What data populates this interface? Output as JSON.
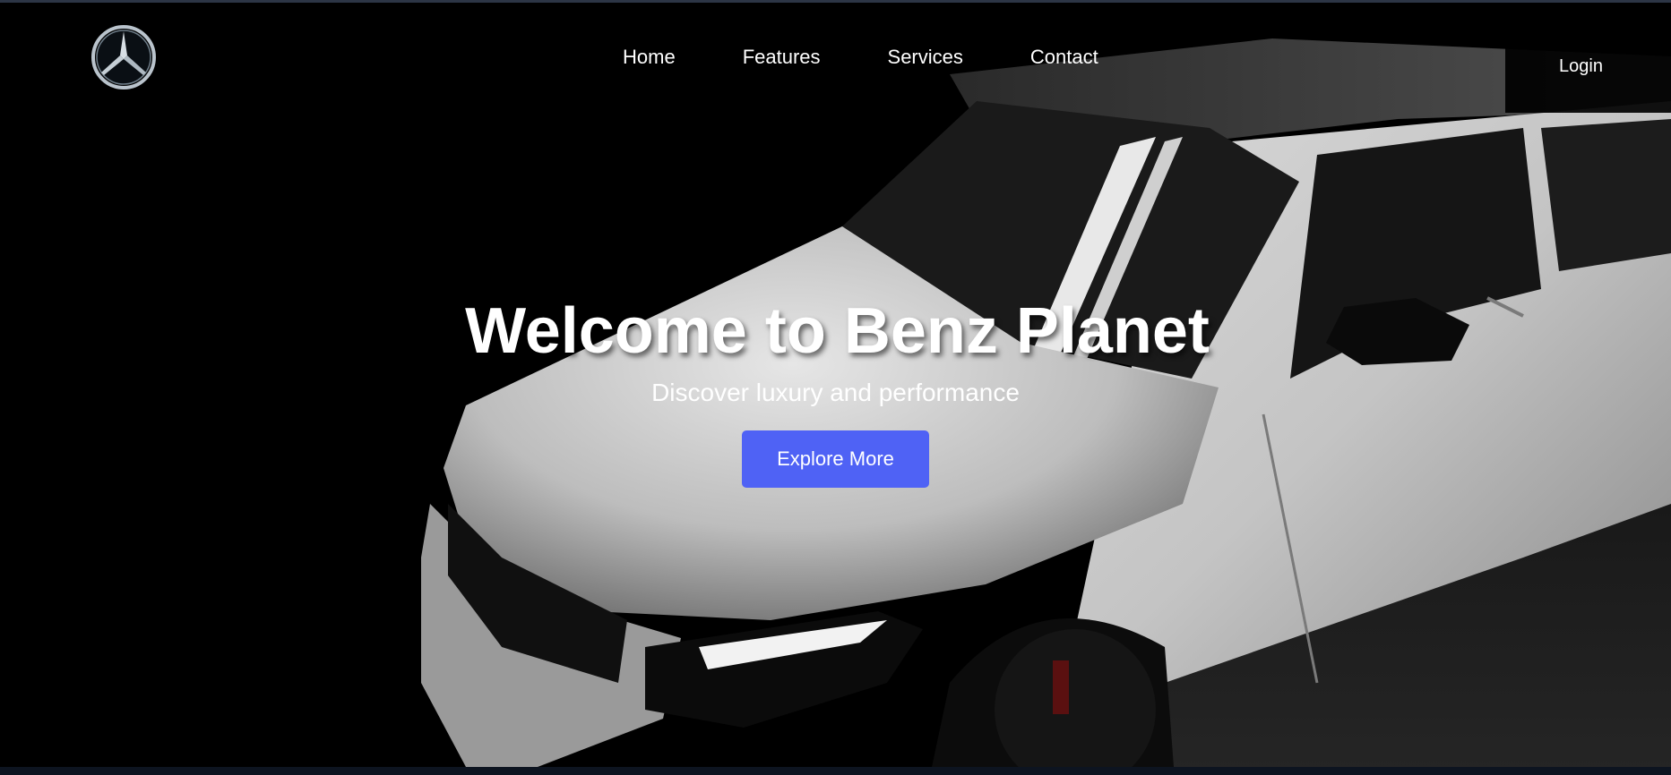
{
  "header": {
    "logo_icon": "mercedes-star-icon",
    "nav": [
      "Home",
      "Features",
      "Services",
      "Contact"
    ],
    "login_label": "Login"
  },
  "hero": {
    "title": "Welcome to Benz Planet",
    "subtitle": "Discover luxury and performance",
    "cta_label": "Explore More",
    "background": "white-mercedes-amg-car-photo"
  },
  "colors": {
    "background": "#000000",
    "accent": "#4f62f5",
    "text": "#ffffff"
  }
}
